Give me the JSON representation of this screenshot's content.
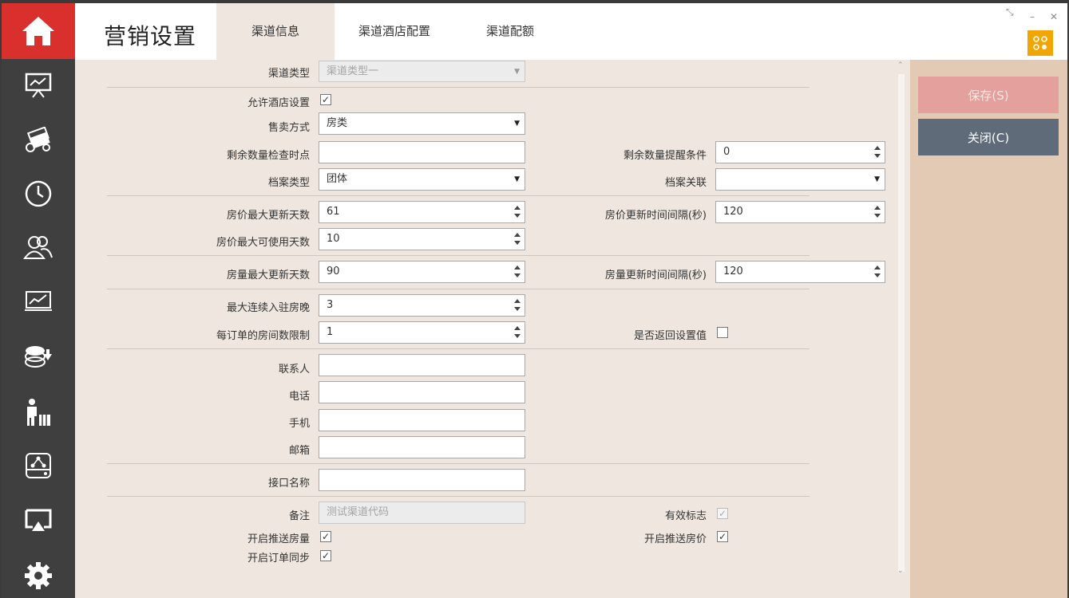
{
  "header": {
    "title": "营销设置",
    "tabs": [
      "渠道信息",
      "渠道酒店配置",
      "渠道配额"
    ],
    "active_tab": 0
  },
  "actions": {
    "save_label": "保存(S)",
    "close_label": "关闭(C)"
  },
  "form": {
    "channel_type_label": "渠道类型",
    "channel_type_value": "渠道类型一",
    "allow_hotel_label": "允许酒店设置",
    "allow_hotel_checked": "✓",
    "sale_mode_label": "售卖方式",
    "sale_mode_value": "房类",
    "remain_check_label": "剩余数量检查时点",
    "remain_check_value": "",
    "remain_alert_label": "剩余数量提醒条件",
    "remain_alert_value": "0",
    "profile_type_label": "档案类型",
    "profile_type_value": "团体",
    "profile_link_label": "档案关联",
    "profile_link_value": "",
    "rate_max_days_label": "房价最大更新天数",
    "rate_max_days_value": "61",
    "rate_interval_label": "房价更新时间间隔(秒)",
    "rate_interval_value": "120",
    "rate_usable_days_label": "房价最大可使用天数",
    "rate_usable_days_value": "10",
    "inv_max_days_label": "房量最大更新天数",
    "inv_max_days_value": "90",
    "inv_interval_label": "房量更新时间间隔(秒)",
    "inv_interval_value": "120",
    "max_nights_label": "最大连续入驻房晚",
    "max_nights_value": "3",
    "rooms_per_order_label": "每订单的房间数限制",
    "rooms_per_order_value": "1",
    "return_setting_label": "是否返回设置值",
    "contact_label": "联系人",
    "phone_label": "电话",
    "mobile_label": "手机",
    "email_label": "邮箱",
    "interface_label": "接口名称",
    "remark_label": "备注",
    "remark_value": "测试渠道代码",
    "valid_flag_label": "有效标志",
    "valid_flag_checked": "✓",
    "push_inventory_label": "开启推送房量",
    "push_inventory_checked": "✓",
    "push_rate_label": "开启推送房价",
    "push_rate_checked": "✓",
    "order_sync_label": "开启订单同步",
    "order_sync_checked": "✓"
  },
  "icons": [
    "home-icon",
    "presentation-icon",
    "money-icon",
    "clock-icon",
    "users-icon",
    "chart-icon",
    "coins-icon",
    "person-luggage-icon",
    "network-icon",
    "screen-cast-icon",
    "gear-icon"
  ],
  "colors": {
    "home_bg": "#d9302d",
    "save_bg": "#e3a09c",
    "close_bg": "#5f6b78",
    "badge_bg": "#f1a500",
    "content_bg": "#efe7df",
    "panel_bg": "#e3cab4"
  }
}
